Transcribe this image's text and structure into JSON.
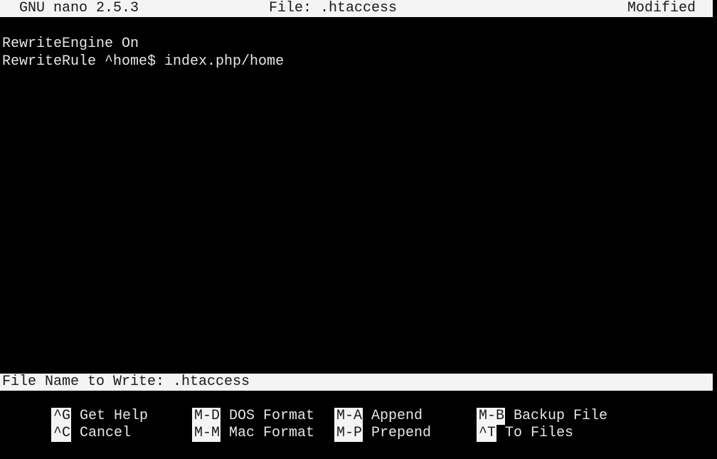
{
  "titlebar": {
    "app": "GNU nano 2.5.3",
    "file": "File: .htaccess",
    "status": "Modified"
  },
  "buffer": {
    "lines": [
      "",
      "RewriteEngine On",
      "RewriteRule ^home$ index.php/home"
    ]
  },
  "prompt": {
    "text": "File Name to Write: .htaccess"
  },
  "shortcuts": [
    {
      "key": "^G",
      "label": "Get Help"
    },
    {
      "key": "M-D",
      "label": "DOS Format"
    },
    {
      "key": "M-A",
      "label": "Append"
    },
    {
      "key": "M-B",
      "label": "Backup File"
    },
    {
      "key": "^C",
      "label": "Cancel"
    },
    {
      "key": "M-M",
      "label": "Mac Format"
    },
    {
      "key": "M-P",
      "label": "Prepend"
    },
    {
      "key": "^T",
      "label": "To Files"
    }
  ],
  "colors": {
    "background": "#000000",
    "foreground": "#e6e6e6",
    "inverse_bg": "#f4f4f4",
    "inverse_fg": "#1a1a1a"
  }
}
